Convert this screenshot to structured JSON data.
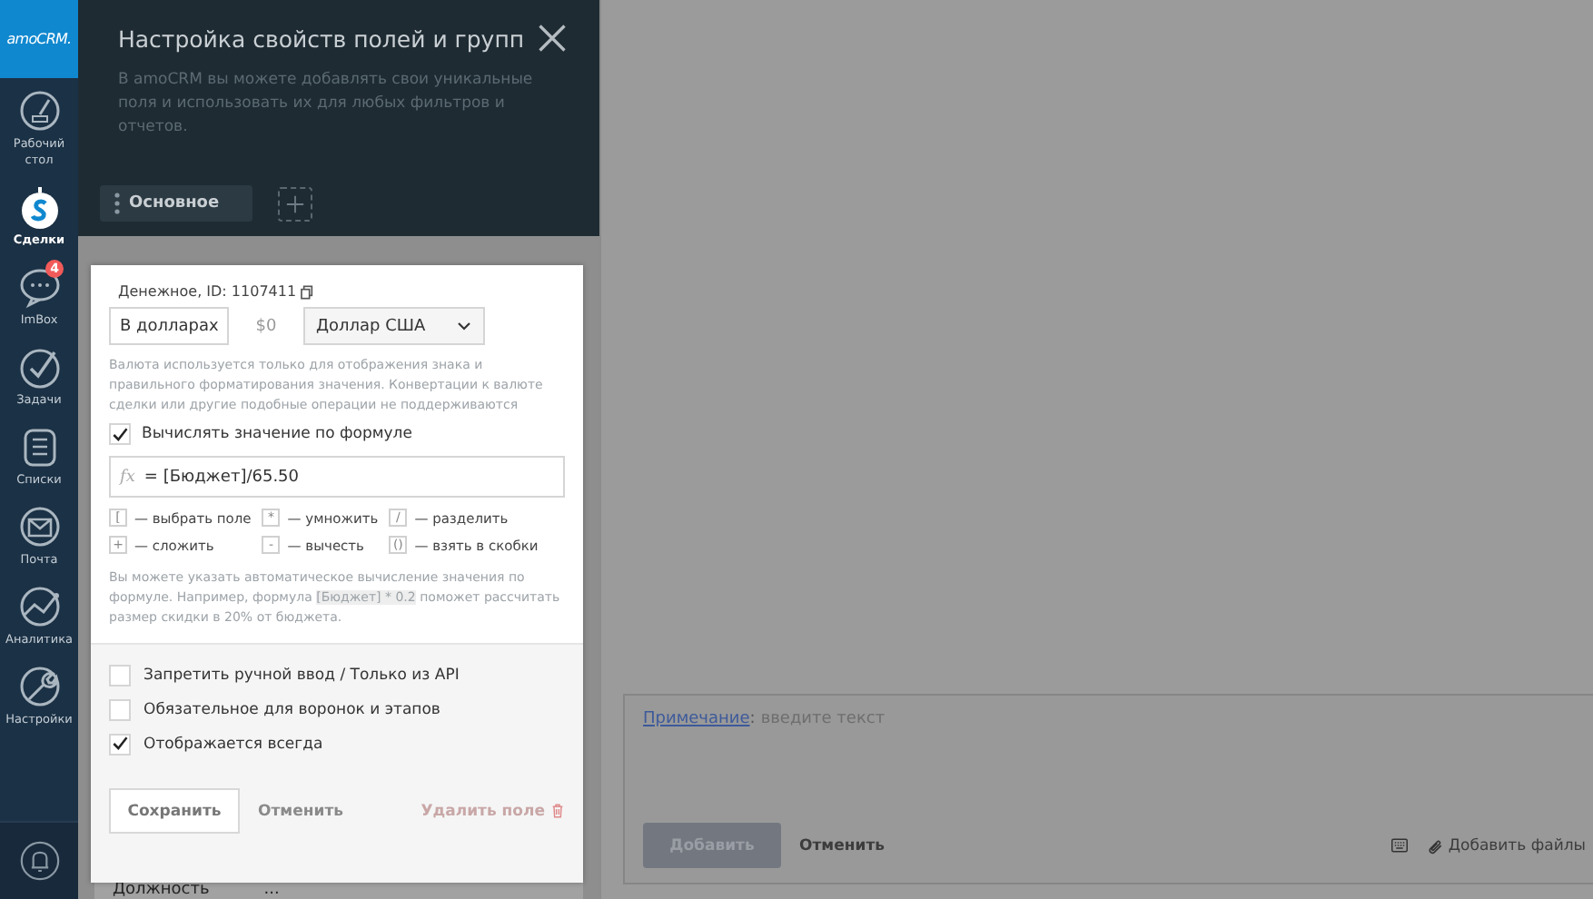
{
  "nav": {
    "logo": "amoCRM.",
    "items": [
      {
        "label": "Рабочий стол",
        "selected": false
      },
      {
        "label": "Сделки",
        "selected": true
      },
      {
        "label": "ImBox",
        "selected": false,
        "badge": "4"
      },
      {
        "label": "Задачи",
        "selected": false
      },
      {
        "label": "Списки",
        "selected": false
      },
      {
        "label": "Почта",
        "selected": false
      },
      {
        "label": "Аналитика",
        "selected": false
      },
      {
        "label": "Настройки",
        "selected": false
      }
    ]
  },
  "panel": {
    "title": "Настройка свойств полей и групп",
    "description": "В amoCRM вы можете добавлять свои уникальные поля и использовать их для любых фильтров и отчетов.",
    "tabs": [
      {
        "label": "Основное",
        "selected": true
      }
    ],
    "list_rows": [
      {
        "name": "Должность",
        "value": "..."
      }
    ]
  },
  "field_card": {
    "type_label": "Денежное, ID: 1107411",
    "name_value": "В долларах",
    "currency_sample": "$0",
    "currency_select": "Доллар США",
    "currency_hint": "Валюта используется только для отображения знака и правильного форматирования значения. Конвертации к валюте сделки или другие подобные операции не поддерживаются",
    "formula_checkbox": {
      "label": "Вычислять значение по формуле",
      "checked": true
    },
    "formula": {
      "prefix": "fx",
      "value": "= [Бюджет]/65.50"
    },
    "legend": [
      {
        "key": "[",
        "label": "— выбрать поле"
      },
      {
        "key": "*",
        "label": "— умножить"
      },
      {
        "key": "/",
        "label": "— разделить"
      },
      {
        "key": "+",
        "label": "— сложить"
      },
      {
        "key": "-",
        "label": "— вычесть"
      },
      {
        "key": "()",
        "label": "— взять в скобки"
      }
    ],
    "formula_hint": {
      "before": "Вы можете указать автоматическое вычисление значения по формуле. Например, формула ",
      "code": "[Бюджет] * 0.2",
      "after": " поможет рассчитать размер скидки в 20% от бюджета."
    },
    "options": [
      {
        "label": "Запретить ручной ввод / Только из API",
        "checked": false
      },
      {
        "label": "Обязательное для воронок и этапов",
        "checked": false
      },
      {
        "label": "Отображается всегда",
        "checked": true
      }
    ],
    "save": "Сохранить",
    "cancel": "Отменить",
    "delete": "Удалить поле"
  },
  "note": {
    "link": "Примечание",
    "colon": ":",
    "placeholder": "введите текст",
    "add": "Добавить",
    "cancel": "Отменить",
    "attach": "Добавить файлы"
  }
}
